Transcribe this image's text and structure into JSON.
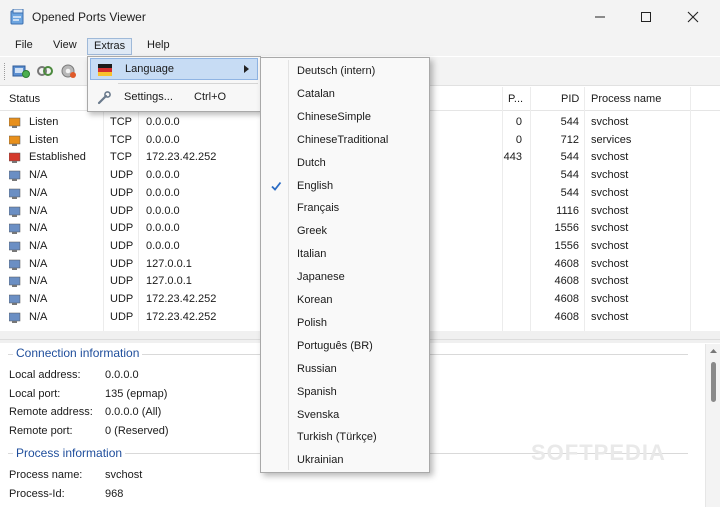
{
  "window": {
    "title": "Opened Ports Viewer",
    "icon": "app-icon"
  },
  "menubar": {
    "items": [
      "File",
      "View",
      "Extras",
      "Help"
    ]
  },
  "toolbar": {
    "icons": [
      "refresh-icon",
      "connect-icon",
      "settings-gear-icon"
    ]
  },
  "list": {
    "columns": [
      "Status",
      "P...",
      "PID",
      "Process name"
    ],
    "rows": [
      {
        "status": "Listen",
        "status_color": "#e8901c",
        "proto": "TCP",
        "local": "0.0.0.0",
        "port": "0",
        "pid": "544",
        "process": "svchost"
      },
      {
        "status": "Listen",
        "status_color": "#e8901c",
        "proto": "TCP",
        "local": "0.0.0.0",
        "port": "0",
        "pid": "712",
        "process": "services"
      },
      {
        "status": "Established",
        "status_color": "#d43a2c",
        "proto": "TCP",
        "local": "172.23.42.252",
        "port": "443",
        "pid": "544",
        "process": "svchost"
      },
      {
        "status": "N/A",
        "status_color": "#6b8fc4",
        "proto": "UDP",
        "local": "0.0.0.0",
        "port": "",
        "pid": "544",
        "process": "svchost"
      },
      {
        "status": "N/A",
        "status_color": "#6b8fc4",
        "proto": "UDP",
        "local": "0.0.0.0",
        "port": "",
        "pid": "544",
        "process": "svchost"
      },
      {
        "status": "N/A",
        "status_color": "#6b8fc4",
        "proto": "UDP",
        "local": "0.0.0.0",
        "port": "",
        "pid": "1116",
        "process": "svchost"
      },
      {
        "status": "N/A",
        "status_color": "#6b8fc4",
        "proto": "UDP",
        "local": "0.0.0.0",
        "port": "",
        "pid": "1556",
        "process": "svchost"
      },
      {
        "status": "N/A",
        "status_color": "#6b8fc4",
        "proto": "UDP",
        "local": "0.0.0.0",
        "port": "",
        "pid": "1556",
        "process": "svchost"
      },
      {
        "status": "N/A",
        "status_color": "#6b8fc4",
        "proto": "UDP",
        "local": "127.0.0.1",
        "port": "",
        "pid": "4608",
        "process": "svchost"
      },
      {
        "status": "N/A",
        "status_color": "#6b8fc4",
        "proto": "UDP",
        "local": "127.0.0.1",
        "port": "",
        "pid": "4608",
        "process": "svchost"
      },
      {
        "status": "N/A",
        "status_color": "#6b8fc4",
        "proto": "UDP",
        "local": "172.23.42.252",
        "port": "",
        "pid": "4608",
        "process": "svchost"
      },
      {
        "status": "N/A",
        "status_color": "#6b8fc4",
        "proto": "UDP",
        "local": "172.23.42.252",
        "port": "",
        "pid": "4608",
        "process": "svchost"
      }
    ]
  },
  "details": {
    "connection_title": "Connection information",
    "local_address_label": "Local address:",
    "local_address_value": "0.0.0.0",
    "local_port_label": "Local port:",
    "local_port_value": "135 (epmap)",
    "remote_address_label": "Remote address:",
    "remote_address_value": "0.0.0.0 (All)",
    "remote_port_label": "Remote port:",
    "remote_port_value": "0 (Reserved)",
    "process_title": "Process information",
    "process_name_label": "Process name:",
    "process_name_value": "svchost",
    "process_id_label": "Process-Id:",
    "process_id_value": "968"
  },
  "extras_menu": {
    "language_label": "Language",
    "settings_label": "Settings...",
    "settings_shortcut": "Ctrl+O"
  },
  "language_menu": {
    "selected": "English",
    "items": [
      "Deutsch (intern)",
      "Catalan",
      "ChineseSimple",
      "ChineseTraditional",
      "Dutch",
      "English",
      "Français",
      "Greek",
      "Italian",
      "Japanese",
      "Korean",
      "Polish",
      "Português (BR)",
      "Russian",
      "Spanish",
      "Svenska",
      "Turkish (Türkçe)",
      "Ukrainian"
    ]
  },
  "watermark": "SOFTPEDIA",
  "colors": {
    "accent": "#1f4e9c",
    "menu_highlight": "#c7dcf4"
  }
}
